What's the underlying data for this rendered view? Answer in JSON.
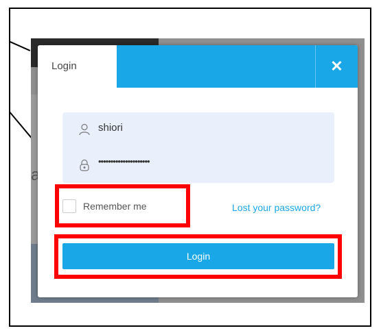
{
  "modal": {
    "tab_label": "Login",
    "close_glyph": "✕",
    "username_value": "shiori",
    "password_mask": "•••••••••••••••••••••",
    "remember_label": "Remember me",
    "lost_password_label": "Lost your password?",
    "login_button_label": "Login"
  },
  "icons": {
    "user": "user-icon",
    "lock": "lock-icon",
    "close": "close-icon"
  },
  "colors": {
    "accent": "#1aa7e8",
    "field_bg": "#e9f0fc",
    "highlight": "#ff0000"
  },
  "background": {
    "letter": "a"
  }
}
